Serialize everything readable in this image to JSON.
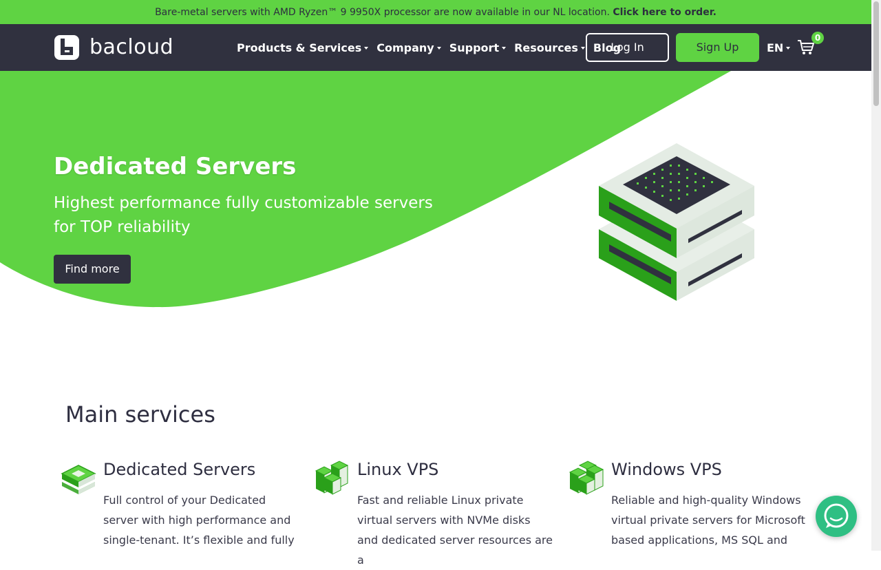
{
  "announcement": {
    "text": "Bare-metal servers with AMD Ryzen™ 9 9950X processor are now available in our NL location. ",
    "link": "Click here to order."
  },
  "nav": {
    "logo_text": "bacloud",
    "menu": [
      {
        "label": "Products & Services"
      },
      {
        "label": "Company"
      },
      {
        "label": "Support"
      },
      {
        "label": "Resources"
      },
      {
        "label": "Blog"
      }
    ],
    "login_label": "Log In",
    "signup_label": "Sign Up",
    "language": "EN",
    "cart_count": "0"
  },
  "hero": {
    "title": "Dedicated Servers",
    "subtitle": "Highest performance fully customizable servers for TOP reliability",
    "button_label": "Find more"
  },
  "services": {
    "title": "Main services",
    "items": [
      {
        "title": "Dedicated Servers",
        "desc": "Full control of your Dedicated server with high performance and single-tenant. It’s flexible and fully"
      },
      {
        "title": "Linux VPS",
        "desc": "Fast and reliable Linux private virtual servers with NVMe disks and dedicated server resources are a"
      },
      {
        "title": "Windows VPS",
        "desc": "Reliable and high-quality Windows virtual private servers for Microsoft based applications, MS SQL and"
      }
    ]
  },
  "colors": {
    "brand_green": "#5fd343",
    "nav_dark": "#30313f",
    "chat_green": "#2fbf83"
  },
  "icons": [
    "logo-icon",
    "caret-down-icon",
    "cart-icon",
    "server-stack-icon",
    "chat-icon"
  ]
}
